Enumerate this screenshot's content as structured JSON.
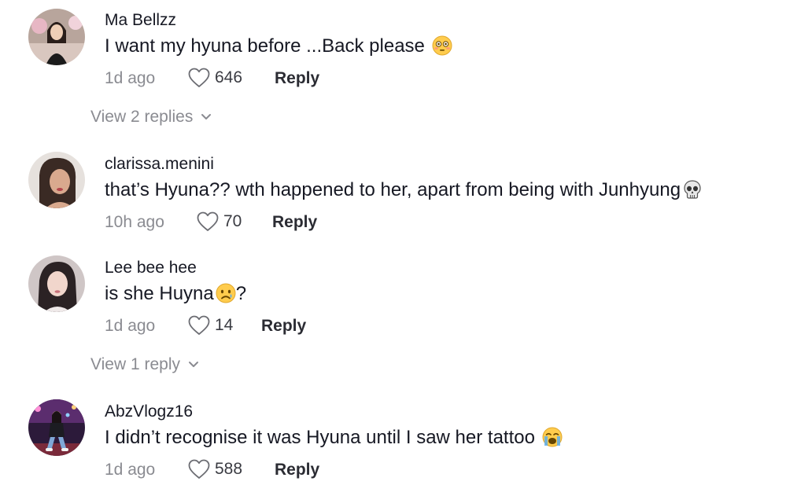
{
  "comments": [
    {
      "username": "Ma Bellzz",
      "text": "I want my hyuna before ...Back please",
      "emoji": "flushed-face-icon",
      "time": "1d ago",
      "likes": "646",
      "reply_label": "Reply",
      "view_replies": "View 2 replies"
    },
    {
      "username": "clarissa.menini",
      "text": "that’s Hyuna?? wth happened to her, apart from being with Junhyung",
      "emoji": "skull-icon",
      "time": "10h ago",
      "likes": "70",
      "reply_label": "Reply"
    },
    {
      "username": "Lee bee hee",
      "text": "is she Huyna",
      "text_suffix": "?",
      "emoji": "sad-face-icon",
      "time": "1d ago",
      "likes": "14",
      "reply_label": "Reply",
      "view_replies": "View 1 reply"
    },
    {
      "username": "AbzVlogz16",
      "text": "I didn’t recognise it was Hyuna until I saw her tattoo",
      "emoji": "crying-face-icon",
      "time": "1d ago",
      "likes": "588",
      "reply_label": "Reply"
    }
  ],
  "colors": {
    "text": "#161823",
    "secondary": "#8a8b91",
    "emoji_yellow": "#ffcc4d"
  }
}
